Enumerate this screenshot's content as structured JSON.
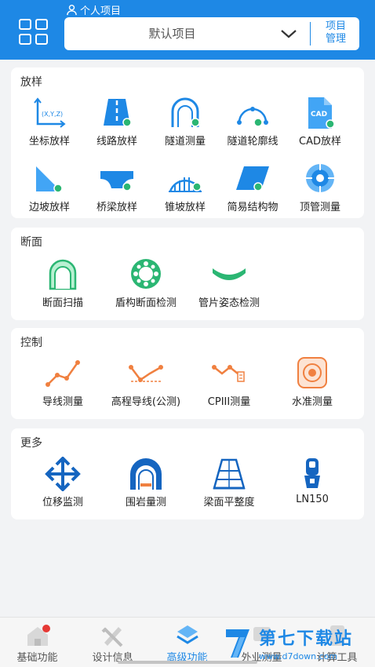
{
  "header": {
    "personal_label": "个人项目",
    "project_value": "默认项目",
    "manage_line1": "项目",
    "manage_line2": "管理"
  },
  "sections": {
    "layout": {
      "title": "放样",
      "items": [
        "坐标放样",
        "线路放样",
        "隧道测量",
        "隧道轮廓线",
        "CAD放样",
        "边坡放样",
        "桥梁放样",
        "锥坡放样",
        "简易结构物",
        "顶管测量"
      ],
      "coord_label": "(X,Y,Z)",
      "cad_label": "CAD"
    },
    "section": {
      "title": "断面",
      "items": [
        "断面扫描",
        "盾构断面检测",
        "管片姿态检测"
      ]
    },
    "control": {
      "title": "控制",
      "items": [
        "导线测量",
        "高程导线(公测)",
        "CPIII测量",
        "水准测量"
      ]
    },
    "more": {
      "title": "更多",
      "items": [
        "位移监测",
        "围岩量测",
        "梁面平整度",
        "LN150"
      ]
    }
  },
  "tabs": [
    "基础功能",
    "设计信息",
    "高级功能",
    "外业测量",
    "计算工具"
  ],
  "watermark": {
    "title": "第七下载站",
    "url": "www.d7down.com"
  },
  "colors": {
    "primary": "#1e88e5",
    "accent_green": "#2bb673",
    "accent_orange": "#f08040",
    "badge_red": "#e53935"
  }
}
